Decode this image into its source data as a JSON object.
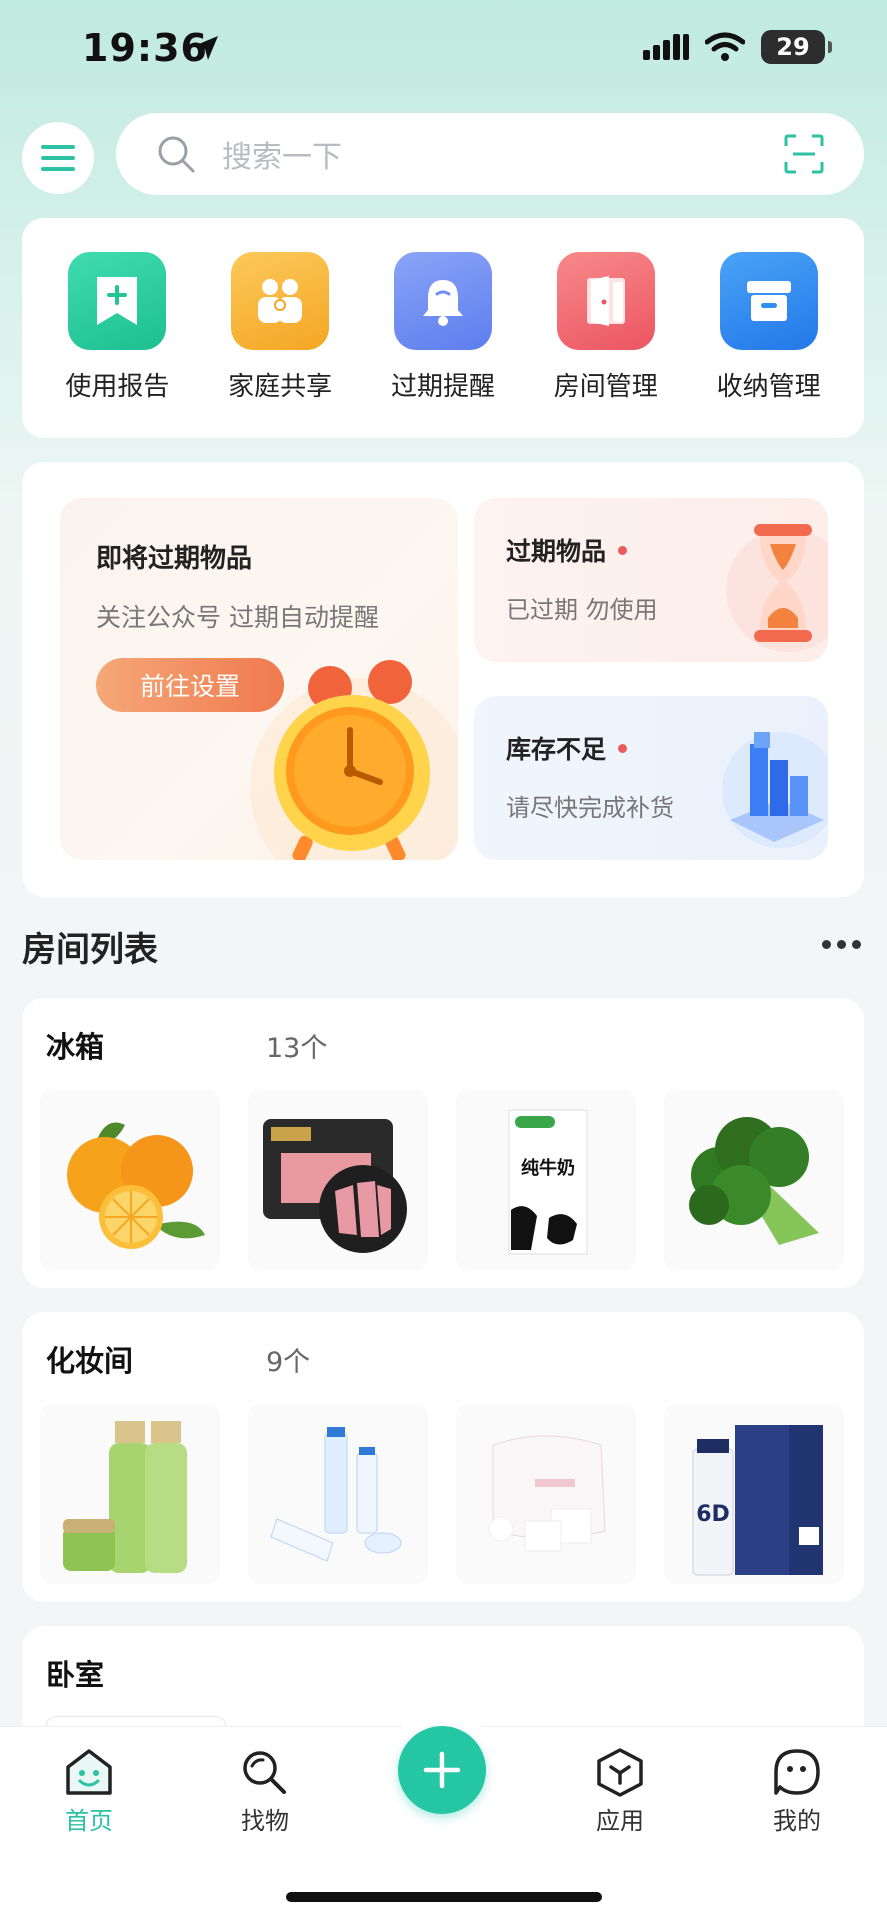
{
  "status": {
    "time": "19:36",
    "battery": "29"
  },
  "search": {
    "placeholder": "搜索一下"
  },
  "quick_actions": [
    {
      "label": "使用报告",
      "icon": "report-bookmark-icon",
      "color": "#2ecfa0"
    },
    {
      "label": "家庭共享",
      "icon": "family-share-icon",
      "color": "#f8b942"
    },
    {
      "label": "过期提醒",
      "icon": "bell-icon",
      "color": "#6f8ff3"
    },
    {
      "label": "房间管理",
      "icon": "door-icon",
      "color": "#f0626c"
    },
    {
      "label": "收纳管理",
      "icon": "storage-box-icon",
      "color": "#2f8ef0"
    }
  ],
  "promo": {
    "expiring": {
      "title": "即将过期物品",
      "subtitle": "关注公众号 过期自动提醒",
      "button": "前往设置"
    },
    "expired": {
      "title": "过期物品",
      "subtitle": "已过期 勿使用"
    },
    "low_stock": {
      "title": "库存不足",
      "subtitle": "请尽快完成补货"
    }
  },
  "rooms_section": {
    "title": "房间列表"
  },
  "rooms": [
    {
      "name": "冰箱",
      "count": "13个",
      "items": [
        "oranges",
        "pork-slices",
        "milk-carton",
        "broccoli"
      ]
    },
    {
      "name": "化妆间",
      "count": "9个",
      "items": [
        "green-skincare-set",
        "blue-skincare-set",
        "cotton-pads",
        "6d-toner"
      ]
    },
    {
      "name": "卧室",
      "count": "",
      "items": []
    }
  ],
  "tabbar": {
    "home": "首页",
    "find": "找物",
    "apps": "应用",
    "mine": "我的"
  },
  "colors": {
    "accent": "#25c6a4",
    "promo_button": "#f07a4e"
  }
}
